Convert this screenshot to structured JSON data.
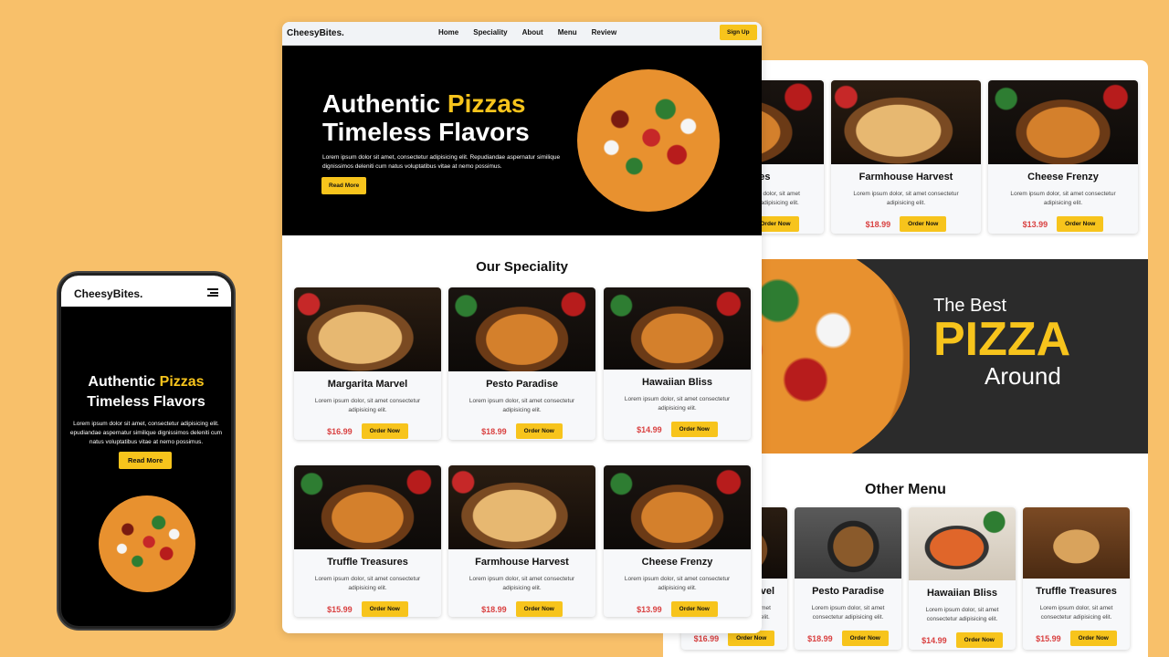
{
  "brand": "CheesyBites.",
  "nav": [
    "Home",
    "Speciality",
    "About",
    "Menu",
    "Review"
  ],
  "signup": "Sign Up",
  "hero": {
    "line1a": "Authentic ",
    "line1b": "Pizzas",
    "line2": "Timeless Flavors",
    "text": "Lorem ipsum dolor sit amet, consectetur adipisicing elit. Repudiandae aspernatur similique dignissimos deleniti cum natus voluptatibus vitae at nemo possimus.",
    "cta": "Read More"
  },
  "speciality": {
    "title": "Our Speciality",
    "desc": "Lorem ipsum dolor, sit amet consectetur adipisicing elit.",
    "order": "Order Now",
    "items": [
      {
        "name": "Margarita Marvel",
        "price": "$16.99"
      },
      {
        "name": "Pesto Paradise",
        "price": "$18.99"
      },
      {
        "name": "Hawaiian Bliss",
        "price": "$14.99"
      },
      {
        "name": "Truffle Treasures",
        "price": "$15.99"
      },
      {
        "name": "Farmhouse Harvest",
        "price": "$18.99"
      },
      {
        "name": "Cheese Frenzy",
        "price": "$13.99"
      }
    ]
  },
  "back": {
    "top": [
      {
        "name": "asures",
        "price": ""
      },
      {
        "name": "Farmhouse Harvest",
        "price": "$18.99"
      },
      {
        "name": "Cheese Frenzy",
        "price": "$13.99"
      }
    ],
    "banner": {
      "l1": "The Best",
      "l2": "PIZZA",
      "l3": "Around"
    },
    "other_title": "Other Menu",
    "other": [
      {
        "name": "vel",
        "price": "$16.99"
      },
      {
        "name": "Pesto Paradise",
        "price": "$18.99"
      },
      {
        "name": "Hawaiian Bliss",
        "price": "$14.99"
      },
      {
        "name": "Truffle Treasures",
        "price": "$15.99"
      }
    ]
  },
  "mobile": {
    "brand": "CheesyBites.",
    "line1a": "Authentic ",
    "line1b": "Pizzas",
    "line2": "Timeless Flavors",
    "text": "Lorem ipsum dolor sit amet, consectetur adipisicing elit. epudiandae aspernatur similique dignissimos deleniti cum natus voluptatibus vitae at nemo possimus.",
    "cta": "Read More"
  },
  "colors": {
    "accent": "#f7c41c",
    "price": "#d94141",
    "bg": "#f8c06a"
  }
}
